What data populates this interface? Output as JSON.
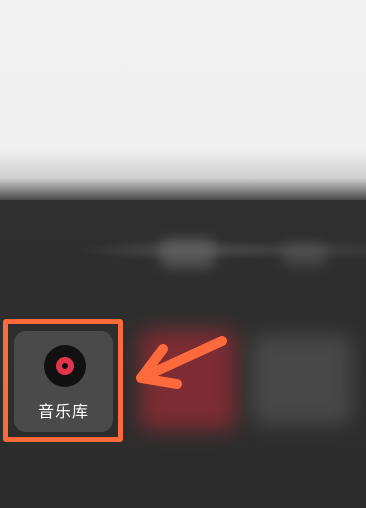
{
  "app_tile": {
    "label": "音乐库",
    "icon": "vinyl-record-icon",
    "icon_accent_color": "#e2354d"
  },
  "annotation": {
    "highlight_color": "#ff6a3d",
    "pointer": "arrow-pointing-left"
  }
}
